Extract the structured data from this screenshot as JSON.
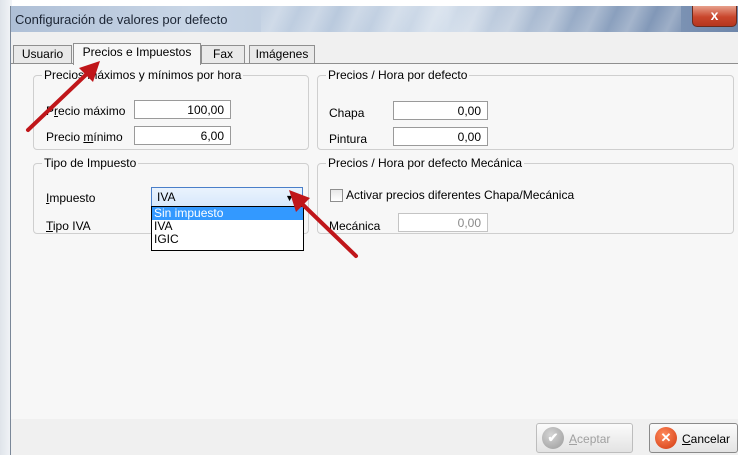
{
  "window": {
    "title": "Configuración de valores por defecto",
    "close_label": "x"
  },
  "tabs": [
    {
      "label": "Usuario",
      "active": false
    },
    {
      "label": "Precios e Impuestos",
      "active": true
    },
    {
      "label": "Fax",
      "active": false
    },
    {
      "label": "Imágenes",
      "active": false
    }
  ],
  "precios_hora": {
    "legend": "Precios máximos y mínimos por hora",
    "max_label_pre": "P",
    "max_label_u": "r",
    "max_label_post": "ecio máximo",
    "max_value": "100,00",
    "min_label_pre": "Precio ",
    "min_label_u": "m",
    "min_label_post": "ínimo",
    "min_value": "6,00"
  },
  "precios_defecto": {
    "legend": "Precios / Hora por defecto",
    "chapa_label": "Chapa",
    "chapa_value": "0,00",
    "pintura_label": "Pintura",
    "pintura_value": "0,00"
  },
  "impuesto": {
    "legend": "Tipo de Impuesto",
    "impuesto_label_u": "I",
    "impuesto_label_post": "mpuesto",
    "selected": "IVA",
    "options": [
      "Sin impuesto",
      "IVA",
      "IGIC"
    ],
    "highlighted_option": "Sin impuesto",
    "tipo_iva_label_u": "T",
    "tipo_iva_label_post": "ipo IVA"
  },
  "mecanica": {
    "legend": "Precios / Hora por defecto Mecánica",
    "checkbox_label": "Activar precios diferentes Chapa/Mecánica",
    "checkbox_checked": false,
    "mecanica_label": "Mecánica",
    "mecanica_value": "0,00"
  },
  "buttons": {
    "accept_label_u": "A",
    "accept_label_post": "ceptar",
    "cancel_label_u": "C",
    "cancel_label_post": "ancelar"
  },
  "colors": {
    "annotation_arrow": "#c0161a",
    "dropdown_highlight": "#3399ff"
  },
  "icons": {
    "accept": "check-circle-icon",
    "cancel": "x-circle-icon"
  }
}
